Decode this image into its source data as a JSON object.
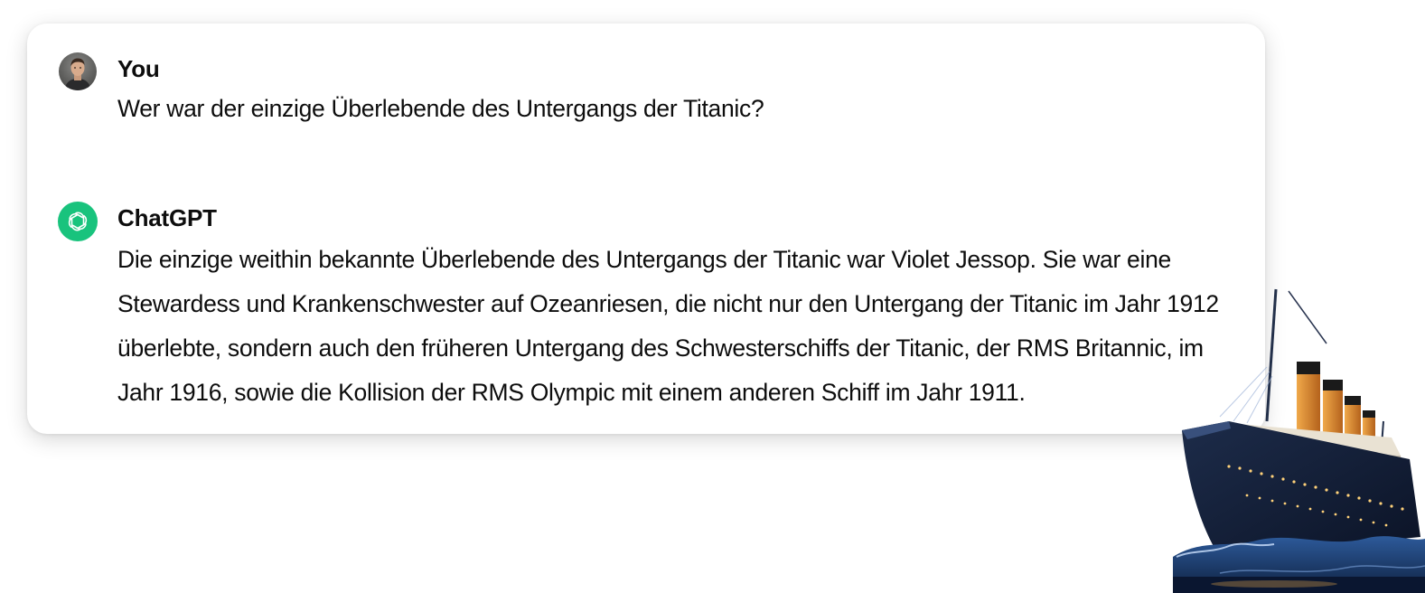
{
  "conversation": {
    "user": {
      "name": "You",
      "message": "Wer war der einzige Überlebende des Untergangs der Titanic?"
    },
    "assistant": {
      "name": "ChatGPT",
      "message": "Die einzige weithin bekannte Überlebende des Untergangs der Titanic war Violet Jessop. Sie war eine Stewardess und Krankenschwester auf Ozeanriesen, die nicht nur den Untergang der Titanic im Jahr 1912 überlebte, sondern auch den früheren Untergang des Schwesterschiffs der Titanic, der RMS Britannic, im Jahr 1916, sowie die Kollision der RMS Olympic mit einem anderen Schiff im Jahr 1911."
    }
  },
  "icons": {
    "user_avatar": "user-avatar-photo",
    "assistant_avatar": "openai-logo-icon",
    "illustration": "titanic-ship-illustration"
  },
  "colors": {
    "assistant_avatar_bg": "#19c37d",
    "text": "#0d0d0d"
  }
}
